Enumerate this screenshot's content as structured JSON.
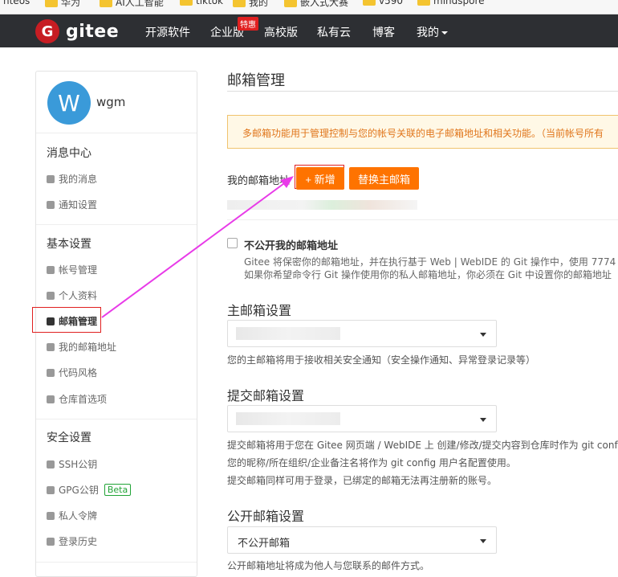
{
  "bookmarks": [
    "nteos",
    "华为",
    "AI人工智能",
    "tiktok",
    "我的",
    "嵌入式大赛",
    "v590",
    "mindspore"
  ],
  "nav": {
    "logo_letter": "G",
    "logo_text": "gitee",
    "items": [
      "开源软件",
      "企业版",
      "高校版",
      "私有云",
      "博客",
      "我的"
    ],
    "badge": "特惠"
  },
  "profile": {
    "avatar_letter": "W",
    "username": "wgm"
  },
  "sidebar": {
    "sections": [
      {
        "title": "消息中心",
        "items": [
          "我的消息",
          "通知设置"
        ]
      },
      {
        "title": "基本设置",
        "items": [
          "帐号管理",
          "个人资料",
          "邮箱管理",
          "我的邮箱地址",
          "代码风格",
          "仓库首选项"
        ]
      },
      {
        "title": "安全设置",
        "items": [
          "SSH公钥",
          "GPG公钥",
          "私人令牌",
          "登录历史"
        ]
      }
    ],
    "beta": "Beta"
  },
  "main": {
    "title": "邮箱管理",
    "notice": "多邮箱功能用于管理控制与您的帐号关联的电子邮箱地址和相关功能。（当前帐号所有",
    "my_email_label": "我的邮箱地址",
    "add_button": "+ 新增",
    "switch_button": "替换主邮箱",
    "hide_email_label": "不公开我的邮箱地址",
    "hide_desc_1": "Gitee 将保密你的邮箱地址，并在执行基于 Web | WebIDE 的 Git 操作中，使用 7774",
    "hide_desc_2": "如果你希望命令行 Git 操作使用你的私人邮箱地址，你必须在 Git 中设置你的邮箱地址",
    "primary_title": "主邮箱设置",
    "primary_hint": "您的主邮箱将用于接收相关安全通知（安全操作通知、异常登录记录等）",
    "commit_title": "提交邮箱设置",
    "commit_hint_1": "提交邮箱将用于您在 Gitee 网页端 / WebIDE 上 创建/修改/提交内容到仓库时作为 git conf",
    "commit_hint_2": "您的昵称/所在组织/企业备注名将作为 git config 用户名配置使用。",
    "commit_hint_3": "提交邮箱同样可用于登录，已绑定的邮箱无法再注册新的账号。",
    "public_title": "公开邮箱设置",
    "public_value": "不公开邮箱",
    "public_hint": "公开邮箱地址将成为他人与您联系的邮件方式。"
  },
  "colors": {
    "accent": "#fe7300",
    "nav_bg": "#2d2f33",
    "annotation": "#e02020",
    "arrow": "#e83be8"
  }
}
